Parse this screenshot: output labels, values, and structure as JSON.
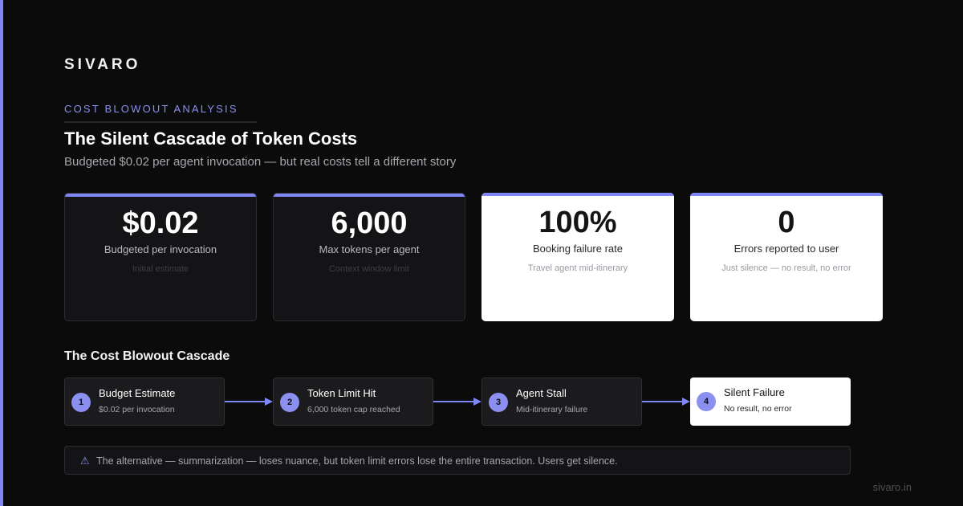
{
  "brand": "SIVARO",
  "header": {
    "eyebrow": "COST BLOWOUT ANALYSIS",
    "title": "The Silent Cascade of Token Costs",
    "subtitle": "Budgeted $0.02 per agent invocation — but real costs tell a different story"
  },
  "stats": [
    {
      "value": "$0.02",
      "label": "Budgeted per invocation",
      "note": "Initial estimate"
    },
    {
      "value": "6,000",
      "label": "Max tokens per agent",
      "note": "Context window limit"
    },
    {
      "value": "100%",
      "label": "Booking failure rate",
      "note": "Travel agent mid-itinerary"
    },
    {
      "value": "0",
      "label": "Errors reported to user",
      "note": "Just silence — no result, no error"
    }
  ],
  "cascade": {
    "title": "The Cost Blowout Cascade",
    "steps": [
      {
        "num": "1",
        "title": "Budget Estimate",
        "sub": "$0.02 per invocation"
      },
      {
        "num": "2",
        "title": "Token Limit Hit",
        "sub": "6,000 token cap reached"
      },
      {
        "num": "3",
        "title": "Agent Stall",
        "sub": "Mid-itinerary failure"
      },
      {
        "num": "4",
        "title": "Silent Failure",
        "sub": "No result, no error"
      }
    ]
  },
  "callout": {
    "icon": "warning-icon",
    "symbol": "⚠",
    "text": "The alternative — summarization — loses nuance, but token limit errors lose the entire transaction. Users get silence."
  },
  "footer": "sivaro.in",
  "colors": {
    "accent": "#7f86f5",
    "background": "#0b0b0c",
    "card_dark": "#141416",
    "card_light": "#ffffff"
  }
}
